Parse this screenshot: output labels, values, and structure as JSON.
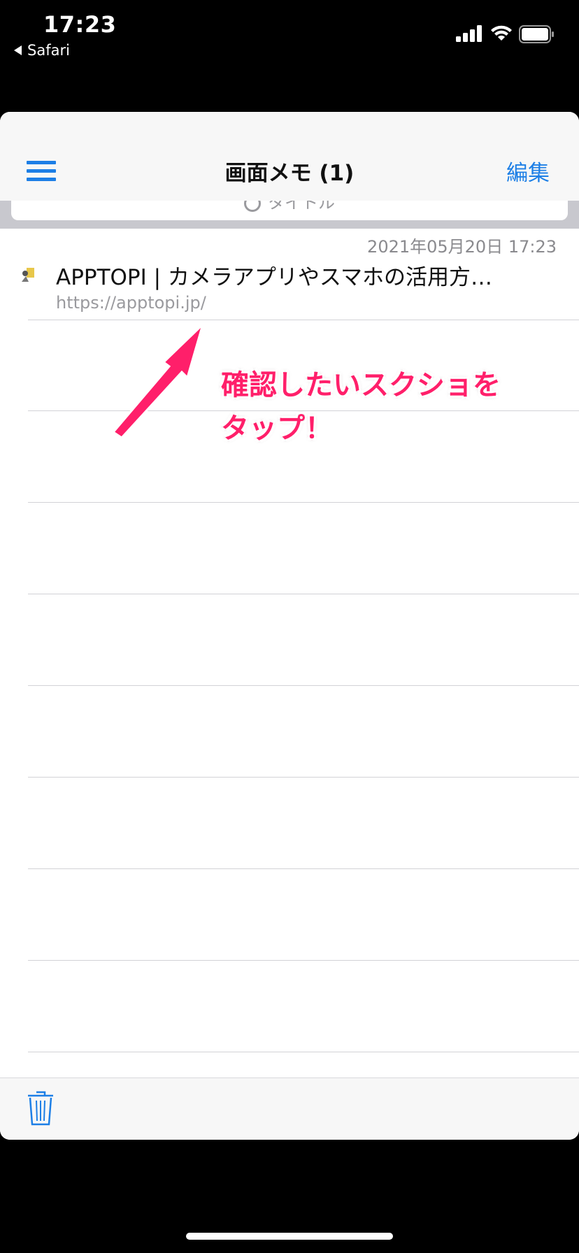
{
  "status_bar": {
    "time": "17:23",
    "back_app": "Safari"
  },
  "nav": {
    "title": "画面メモ (1)",
    "edit_label": "編集"
  },
  "search": {
    "placeholder": "タイトル"
  },
  "memos": [
    {
      "date": "2021年05月20日 17:23",
      "title": "APPTOPI | カメラアプリやスマホの活用方…",
      "url": "https://apptopi.jp/"
    }
  ],
  "annotation": {
    "line1": "確認したいスクショを",
    "line2": "タップ！",
    "color": "#ff1f6a"
  },
  "icons": {
    "menu": "hamburger-menu-icon",
    "trash": "trash-icon",
    "signal": "cellular-signal-icon",
    "wifi": "wifi-icon",
    "battery": "battery-icon"
  },
  "colors": {
    "accent": "#1d7fe6"
  }
}
